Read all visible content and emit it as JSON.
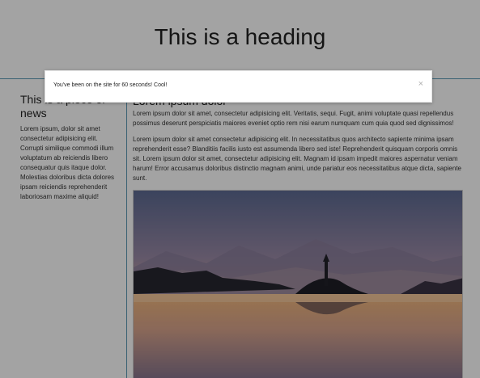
{
  "header": {
    "title": "This is a heading"
  },
  "sidebar": {
    "news_title": "This is a piece of news",
    "news_body": "Lorem ipsum, dolor sit amet consectetur adipisicing elit. Corrupti similique commodi illum voluptatum ab reiciendis libero consequatur quis itaque dolor. Molestias doloribus dicta dolores ipsam reiciendis reprehenderit laboriosam maxime aliquid!"
  },
  "main": {
    "heading": "Lorem ipsum dolor",
    "paragraph1": "Lorem ipsum dolor sit amet, consectetur adipisicing elit. Veritatis, sequi. Fugit, animi voluptate quasi repellendus possimus deserunt perspiciatis maiores eveniet optio rem nisi earum numquam cum quia quod sed dignissimos!",
    "paragraph2": "Lorem ipsum dolor sit amet consectetur adipisicing elit. In necessitatibus quos architecto sapiente minima ipsam reprehenderit esse? Blanditiis facilis iusto est assumenda libero sed iste! Reprehenderit quisquam corporis omnis sit. Lorem ipsum dolor sit amet, consectetur adipisicing elit. Magnam id ipsam impedit maiores aspernatur veniam harum! Error accusamus doloribus distinctio magnam animi, unde pariatur eos necessitatibus atque dicta, sapiente sunt."
  },
  "toast": {
    "message": "You've been on the site for 60 seconds! Cool!",
    "close_label": "×"
  },
  "icons": {
    "close": "close-icon"
  },
  "colors": {
    "divider": "#5a98b5",
    "overlay": "rgba(0,0,0,0.36)"
  }
}
